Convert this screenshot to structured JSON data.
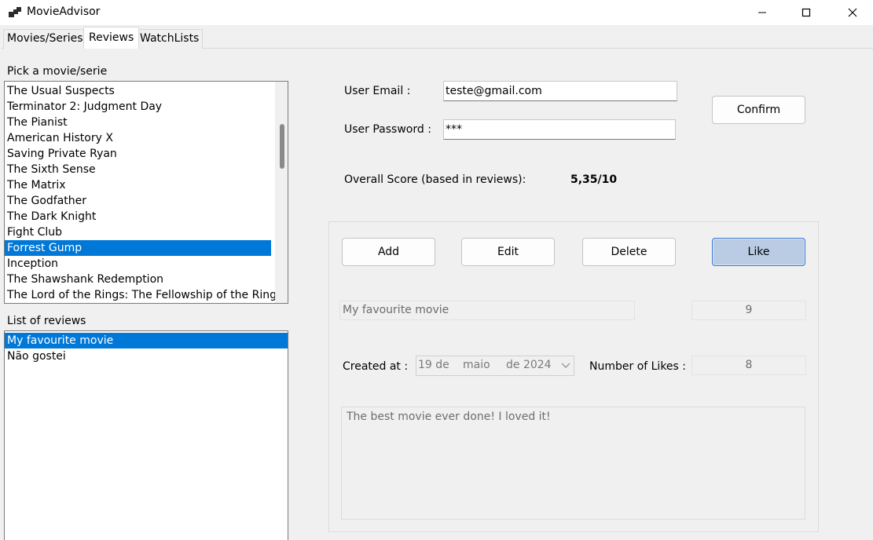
{
  "window": {
    "title": "MovieAdvisor",
    "controls": {
      "minimize": "—",
      "maximize": "☐",
      "close": "✕"
    }
  },
  "tabs": [
    {
      "label": "Movies/Series",
      "active": false
    },
    {
      "label": "Reviews",
      "active": true
    },
    {
      "label": "WatchLists",
      "active": false
    }
  ],
  "movies": {
    "label": "Pick a movie/serie",
    "items": [
      "The Usual Suspects",
      "Terminator 2: Judgment Day",
      "The Pianist",
      "American History X",
      "Saving Private Ryan",
      "The Sixth Sense",
      "The Matrix",
      "The Godfather",
      "The Dark Knight",
      "Fight Club",
      "Forrest Gump",
      "Inception",
      "The Shawshank Redemption",
      "The Lord of the Rings: The Fellowship of the Ring"
    ],
    "selected": "Forrest Gump"
  },
  "reviews": {
    "label": "List of reviews",
    "items": [
      "My favourite movie",
      "Não gostei"
    ],
    "selected": "My favourite movie"
  },
  "auth": {
    "email_label": "User Email :",
    "email_value": "teste@gmail.com",
    "password_label": "User Password :",
    "password_value": "***",
    "confirm_label": "Confirm"
  },
  "score": {
    "label": "Overall Score (based in reviews):",
    "value": "5,35/10"
  },
  "actions": {
    "add": "Add",
    "edit": "Edit",
    "delete": "Delete",
    "like": "Like"
  },
  "review_detail": {
    "title": "My favourite movie",
    "rating": "9",
    "created_label": "Created at :",
    "created_day": "19 de",
    "created_month": "maio",
    "created_year": "de 2024",
    "likes_label": "Number of Likes :",
    "likes_value": "8",
    "content": "The best movie ever done! I loved it!"
  },
  "colors": {
    "selection": "#0078d7",
    "like_button": "#b9cce4"
  }
}
